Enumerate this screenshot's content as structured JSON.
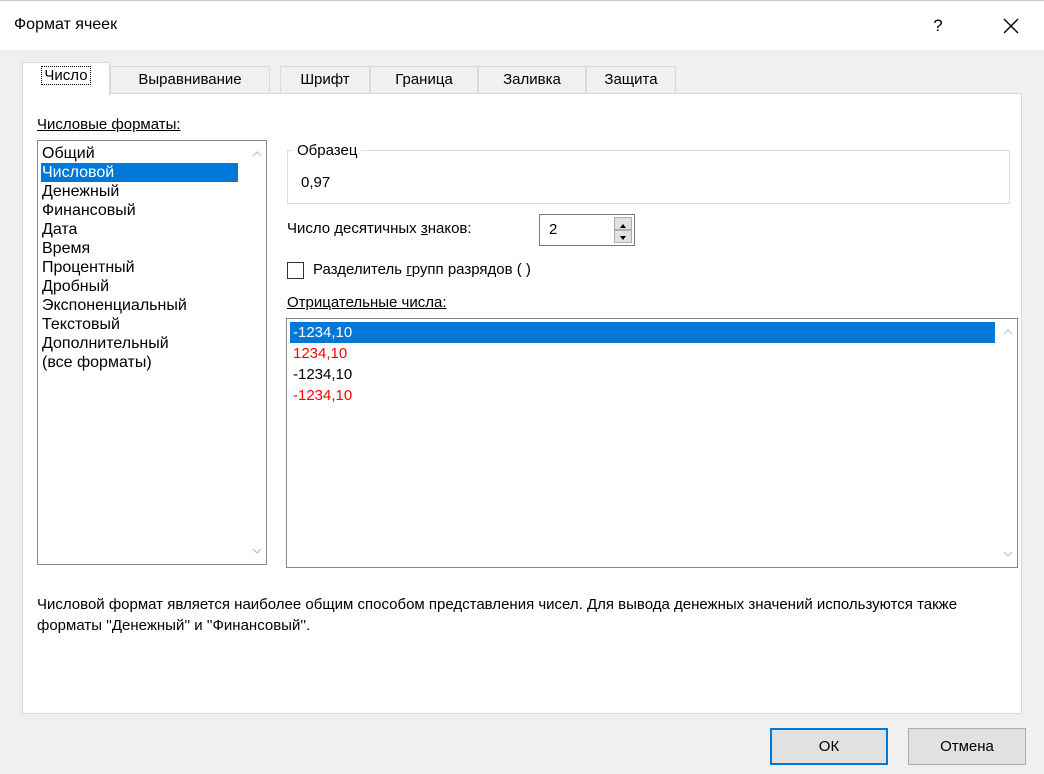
{
  "window": {
    "title": "Формат ячеек",
    "help_label": "?"
  },
  "tabs": [
    {
      "label": "Число",
      "active": true
    },
    {
      "label": "Выравнивание",
      "active": false
    },
    {
      "label": "Шрифт",
      "active": false
    },
    {
      "label": "Граница",
      "active": false
    },
    {
      "label": "Заливка",
      "active": false
    },
    {
      "label": "Защита",
      "active": false
    }
  ],
  "categories": {
    "label": "Числовые форматы:",
    "items": [
      "Общий",
      "Числовой",
      "Денежный",
      "Финансовый",
      "Дата",
      "Время",
      "Процентный",
      "Дробный",
      "Экспоненциальный",
      "Текстовый",
      "Дополнительный",
      "(все форматы)"
    ],
    "selected_index": 1
  },
  "sample": {
    "label": "Образец",
    "value": "0,97"
  },
  "decimal_places": {
    "label": "Число десятичных знаков:",
    "value": "2"
  },
  "thousands_separator": {
    "label": "Разделитель групп разрядов ( )",
    "checked": false
  },
  "negative_numbers": {
    "label": "Отрицательные числа:",
    "items": [
      {
        "text": "-1234,10",
        "color": "#000000"
      },
      {
        "text": "1234,10",
        "color": "#ff0000"
      },
      {
        "text": "-1234,10",
        "color": "#000000"
      },
      {
        "text": "-1234,10",
        "color": "#ff0000"
      }
    ],
    "selected_index": 0
  },
  "description": "Числовой формат является наиболее общим способом представления чисел. Для вывода денежных значений используются также форматы ''Денежный'' и ''Финансовый''.",
  "buttons": {
    "ok": "ОК",
    "cancel": "Отмена"
  },
  "colors": {
    "selection": "#0078d7",
    "negative_red": "#ff0000"
  }
}
